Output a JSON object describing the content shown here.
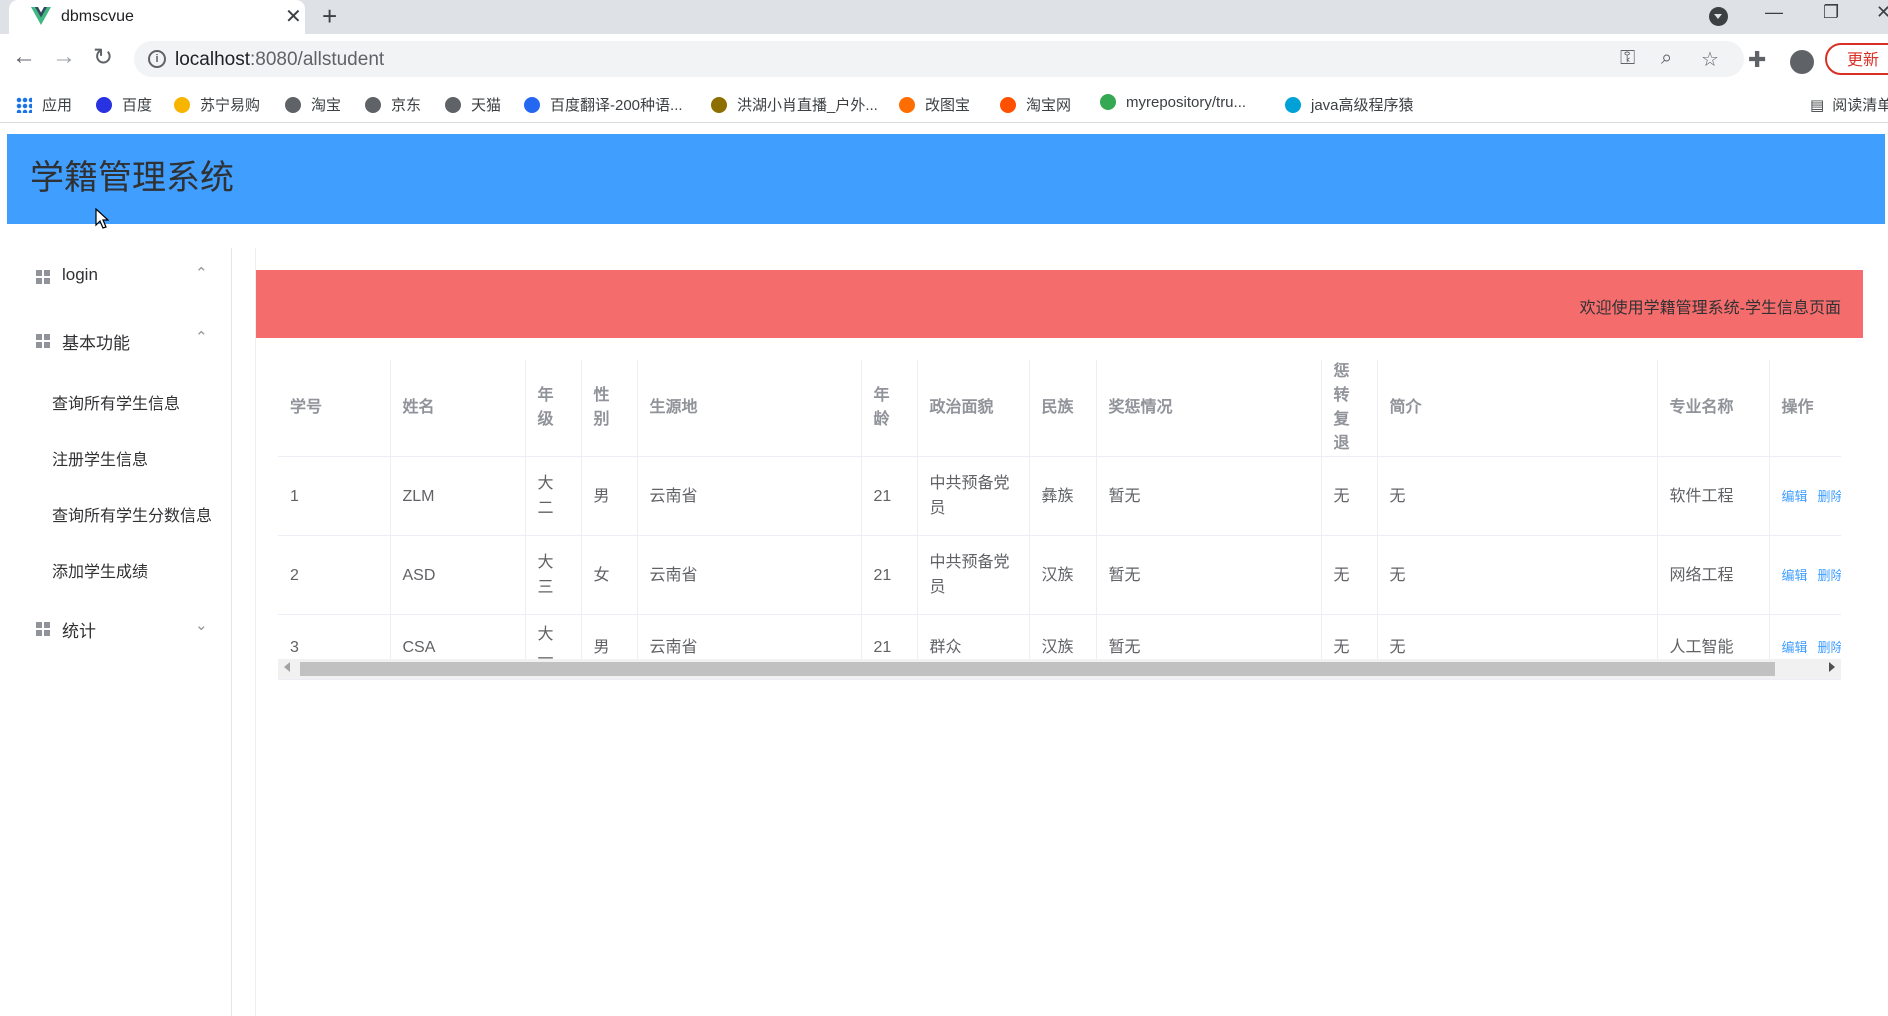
{
  "browser": {
    "tab_title": "dbmscvue",
    "url_host": "localhost",
    "url_rest": ":8080/allstudent",
    "update_label": "更新",
    "bookmarks": [
      {
        "label": "应用",
        "color": "#1a73e8"
      },
      {
        "label": "百度",
        "color": "#2932e1"
      },
      {
        "label": "苏宁易购",
        "color": "#f7b500"
      },
      {
        "label": "淘宝",
        "color": "#5f6368"
      },
      {
        "label": "京东",
        "color": "#5f6368"
      },
      {
        "label": "天猫",
        "color": "#5f6368"
      },
      {
        "label": "百度翻译-200种语...",
        "color": "#2468f2"
      },
      {
        "label": "洪湖小肖直播_户外...",
        "color": "#8d6e00"
      },
      {
        "label": "改图宝",
        "color": "#ff6d00"
      },
      {
        "label": "淘宝网",
        "color": "#ff5000"
      },
      {
        "label": "myrepository/tru...",
        "color": "#34a853"
      },
      {
        "label": "java高级程序猿",
        "color": "#00a1d6"
      }
    ],
    "reading_list": "阅读清单"
  },
  "app": {
    "title": "学籍管理系统",
    "welcome": "欢迎使用学籍管理系统-学生信息页面"
  },
  "sidebar": {
    "groups": [
      {
        "label": "login",
        "arrow": "⌃"
      },
      {
        "label": "基本功能",
        "arrow": "⌃"
      },
      {
        "label": "统计",
        "arrow": "⌄"
      }
    ],
    "sub_items": [
      "查询所有学生信息",
      "注册学生信息",
      "查询所有学生分数信息",
      "添加学生成绩"
    ]
  },
  "table": {
    "headers": [
      "学号",
      "姓名",
      "年级",
      "性别",
      "生源地",
      "年龄",
      "政治面貌",
      "民族",
      "奖惩情况",
      "惩转复退",
      "简介",
      "专业名称",
      "操作"
    ],
    "rows": [
      [
        "1",
        "ZLM",
        "大二",
        "男",
        "云南省",
        "21",
        "中共预备党员",
        "彝族",
        "暂无",
        "无",
        "无",
        "软件工程"
      ],
      [
        "2",
        "ASD",
        "大三",
        "女",
        "云南省",
        "21",
        "中共预备党员",
        "汉族",
        "暂无",
        "无",
        "无",
        "网络工程"
      ],
      [
        "3",
        "CSA",
        "大一",
        "男",
        "云南省",
        "21",
        "群众",
        "汉族",
        "暂无",
        "无",
        "无",
        "人工智能"
      ]
    ],
    "edit_label": "编辑",
    "delete_label": "删除"
  }
}
